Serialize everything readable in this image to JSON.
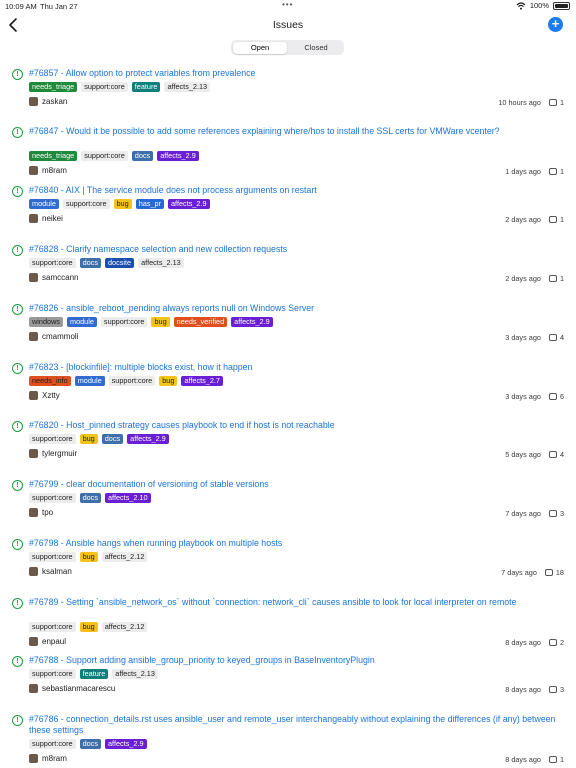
{
  "status_bar": {
    "time": "10:09 AM",
    "date": "Thu Jan 27",
    "battery": "100%"
  },
  "nav": {
    "title": "Issues"
  },
  "segments": {
    "open": "Open",
    "closed": "Closed"
  },
  "label_colors": {
    "needs_triage": {
      "bg": "#1f8a3a",
      "fg": "#ffffff"
    },
    "support:core": {
      "bg": "#ececec",
      "fg": "#222222"
    },
    "feature": {
      "bg": "#0e7f7c",
      "fg": "#ffffff"
    },
    "affects_2.13": {
      "bg": "#ececec",
      "fg": "#222222"
    },
    "affects_2.12": {
      "bg": "#ececec",
      "fg": "#222222"
    },
    "affects_2.9": {
      "bg": "#6a1fd6",
      "fg": "#ffffff"
    },
    "affects_2.10": {
      "bg": "#6a1fd6",
      "fg": "#ffffff"
    },
    "affects_2.7": {
      "bg": "#6a1fd6",
      "fg": "#ffffff"
    },
    "docs": {
      "bg": "#3d6fa8",
      "fg": "#ffffff"
    },
    "docsite": {
      "bg": "#1a4fb0",
      "fg": "#ffffff"
    },
    "module": {
      "bg": "#2f6bd1",
      "fg": "#ffffff"
    },
    "bug": {
      "bg": "#f2c418",
      "fg": "#222222"
    },
    "has_pr": {
      "bg": "#2a68d6",
      "fg": "#ffffff"
    },
    "windows": {
      "bg": "#9a9a9a",
      "fg": "#222222"
    },
    "needs_verified": {
      "bg": "#e0501f",
      "fg": "#ffffff"
    },
    "needs_info": {
      "bg": "#e0501f",
      "fg": "#222222"
    }
  },
  "issues": [
    {
      "title": "#76857 - Allow option to protect variables from prevalence",
      "labels": [
        "needs_triage",
        "support:core",
        "feature",
        "affects_2.13"
      ],
      "author": "zaskan",
      "time": "10 hours ago",
      "comments": "1"
    },
    {
      "title": "#76847 - Would it be possible to add some references explaining where/hos to install the SSL certs for VMWare vcenter?",
      "labels": [
        "needs_triage",
        "support:core",
        "docs",
        "affects_2.9"
      ],
      "author": "m8ram",
      "time": "1 days ago",
      "comments": "1"
    },
    {
      "title": "#76840 - AIX | The service module does not process arguments on restart",
      "labels": [
        "module",
        "support:core",
        "bug",
        "has_pr",
        "affects_2.9"
      ],
      "author": "neikei",
      "time": "2 days ago",
      "comments": "1"
    },
    {
      "title": "#76828 - Clarify namespace selection and new collection requests",
      "labels": [
        "support:core",
        "docs",
        "docsite",
        "affects_2.13"
      ],
      "author": "samccann",
      "time": "2 days ago",
      "comments": "1"
    },
    {
      "title": "#76826 - ansible_reboot_pending always reports null on Windows Server",
      "labels": [
        "windows",
        "module",
        "support:core",
        "bug",
        "needs_verified",
        "affects_2.9"
      ],
      "author": "cmammoli",
      "time": "3 days ago",
      "comments": "4"
    },
    {
      "title": "#76823 - [blockinfile]: multiple blocks exist, how it happen",
      "labels": [
        "needs_info",
        "module",
        "support:core",
        "bug",
        "affects_2.7"
      ],
      "author": "Xztty",
      "time": "3 days ago",
      "comments": "6"
    },
    {
      "title": "#76820 - Host_pinned strategy causes playbook to end if host is not reachable",
      "labels": [
        "support:core",
        "bug",
        "docs",
        "affects_2.9"
      ],
      "author": "tylergmuir",
      "time": "5 days ago",
      "comments": "4"
    },
    {
      "title": "#76799 - clear documentation of versioning of stable versions",
      "labels": [
        "support:core",
        "docs",
        "affects_2.10"
      ],
      "author": "tpo",
      "time": "7 days ago",
      "comments": "3"
    },
    {
      "title": "#76798 - Ansible hangs when running playbook on multiple hosts",
      "labels": [
        "support:core",
        "bug",
        "affects_2.12"
      ],
      "author": "ksalman",
      "time": "7 days ago",
      "comments": "18"
    },
    {
      "title": "#76789 - Setting `ansible_network_os` without `connection: network_cli` causes ansible to look for local interpreter on remote",
      "labels": [
        "support:core",
        "bug",
        "affects_2.12"
      ],
      "author": "enpaul",
      "time": "8 days ago",
      "comments": "2"
    },
    {
      "title": "#76788 - Support adding ansible_group_priority to keyed_groups in BaseInventoryPlugin",
      "labels": [
        "support:core",
        "feature",
        "affects_2.13"
      ],
      "author": "sebastianmacarescu",
      "time": "8 days ago",
      "comments": "3"
    },
    {
      "title": "#76786 - connection_details.rst uses ansible_user and remote_user interchangeably without explaining the differences (if any) between these settings",
      "labels": [
        "support:core",
        "docs",
        "affects_2.9"
      ],
      "author": "m8ram",
      "time": "8 days ago",
      "comments": "1"
    }
  ]
}
